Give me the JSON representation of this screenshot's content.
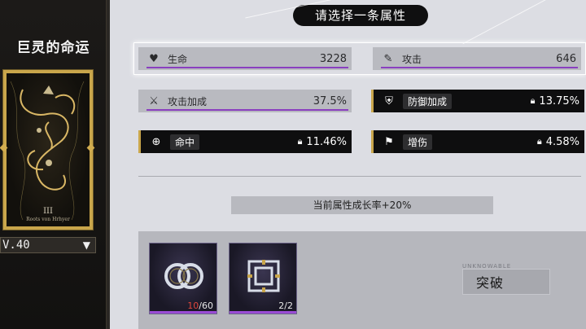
{
  "card": {
    "title": "巨灵的命运",
    "rank": "III",
    "subtitle": "Roots von Hrhyer",
    "level": "V.40"
  },
  "header": {
    "title": "请选择一条属性"
  },
  "stats": {
    "hp": {
      "label": "生命",
      "value": "3228",
      "icon": "heart-icon"
    },
    "atk": {
      "label": "攻击",
      "value": "646",
      "icon": "sword-icon"
    },
    "atk_bonus": {
      "label": "攻击加成",
      "value": "37.5%",
      "icon": "sword-up-icon"
    },
    "def_bonus": {
      "label": "防御加成",
      "value": "13.75%",
      "icon": "shield-icon"
    },
    "crit": {
      "label": "命中",
      "value": "11.46%",
      "icon": "target-icon"
    },
    "dmg": {
      "label": "增伤",
      "value": "4.58%",
      "icon": "flag-icon"
    }
  },
  "growth": {
    "text": "当前属性成长率+20%"
  },
  "materials": [
    {
      "name": "knot-crystal",
      "have": "10",
      "need": "/60"
    },
    {
      "name": "seal-crystal",
      "have": "2",
      "need": "/2"
    }
  ],
  "breakthrough": {
    "label": "突破",
    "tag": "UNKNOWABLE"
  },
  "colors": {
    "accent_purple": "#8a3fbf",
    "gold": "#c9a64b"
  }
}
